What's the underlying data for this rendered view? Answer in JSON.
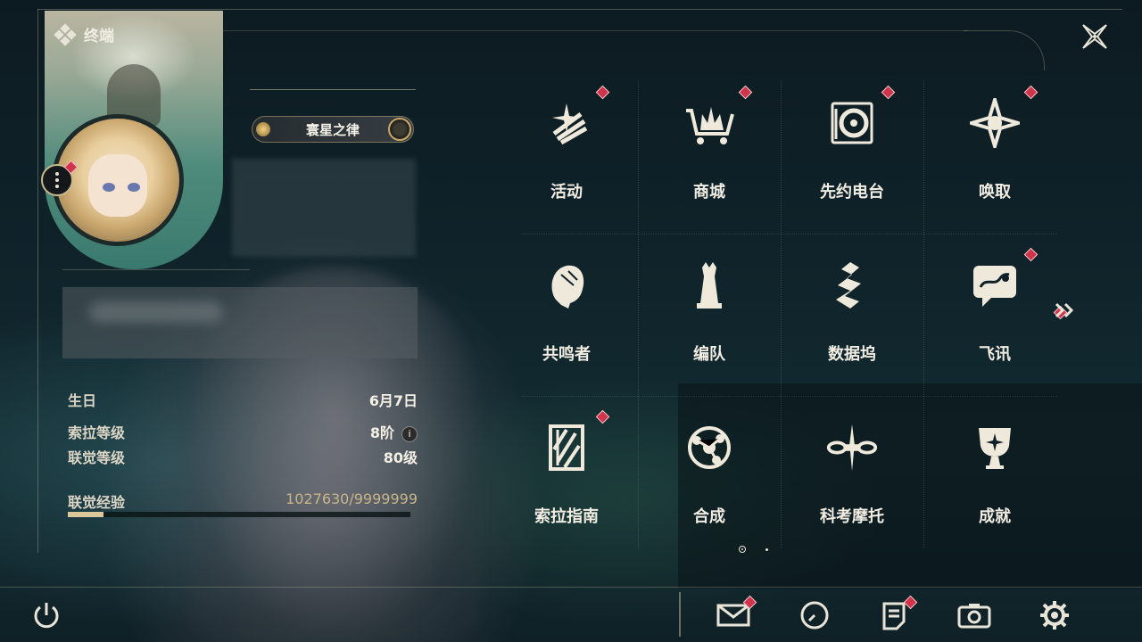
{
  "header": {
    "title": "终端",
    "icon": "terminal-diamond-icon"
  },
  "profile": {
    "title_badge": "寰星之律",
    "stats": [
      {
        "label": "生日",
        "value": "6月7日"
      },
      {
        "label": "索拉等级",
        "value": "8阶",
        "info_icon": "info-icon"
      },
      {
        "label": "联觉等级",
        "value": "80级"
      },
      {
        "label": "联觉经验",
        "value": "1027630/9999999",
        "progress": 0.103
      }
    ]
  },
  "grid": {
    "items": [
      {
        "label": "活动",
        "icon": "events-icon",
        "badge": true
      },
      {
        "label": "商城",
        "icon": "shop-cart-icon",
        "badge": true
      },
      {
        "label": "先约电台",
        "icon": "pioneer-radio-icon",
        "badge": true
      },
      {
        "label": "唤取",
        "icon": "convene-icon",
        "badge": true
      },
      {
        "label": "共鸣者",
        "icon": "resonator-icon",
        "badge": false
      },
      {
        "label": "编队",
        "icon": "team-chess-icon",
        "badge": false
      },
      {
        "label": "数据坞",
        "icon": "data-bank-icon",
        "badge": false
      },
      {
        "label": "飞讯",
        "icon": "messenger-icon",
        "badge": true
      },
      {
        "label": "索拉指南",
        "icon": "guidebook-icon",
        "badge": true
      },
      {
        "label": "合成",
        "icon": "synthesis-icon",
        "badge": false
      },
      {
        "label": "科考摩托",
        "icon": "motorbike-icon",
        "badge": false
      },
      {
        "label": "成就",
        "icon": "achievement-trophy-icon",
        "badge": false
      }
    ],
    "pagination": {
      "current": 1,
      "total": 2
    }
  },
  "bottom_bar": {
    "power": "power-icon",
    "buttons": [
      {
        "icon": "mail-icon",
        "badge": true
      },
      {
        "icon": "clock-icon",
        "badge": false
      },
      {
        "icon": "notice-icon",
        "badge": true
      },
      {
        "icon": "camera-icon",
        "badge": false
      },
      {
        "icon": "settings-gear-icon",
        "badge": false
      }
    ]
  },
  "colors": {
    "accent_gold": "#c8a96a",
    "badge_red": "#d0334a",
    "text": "#f1ede3"
  }
}
